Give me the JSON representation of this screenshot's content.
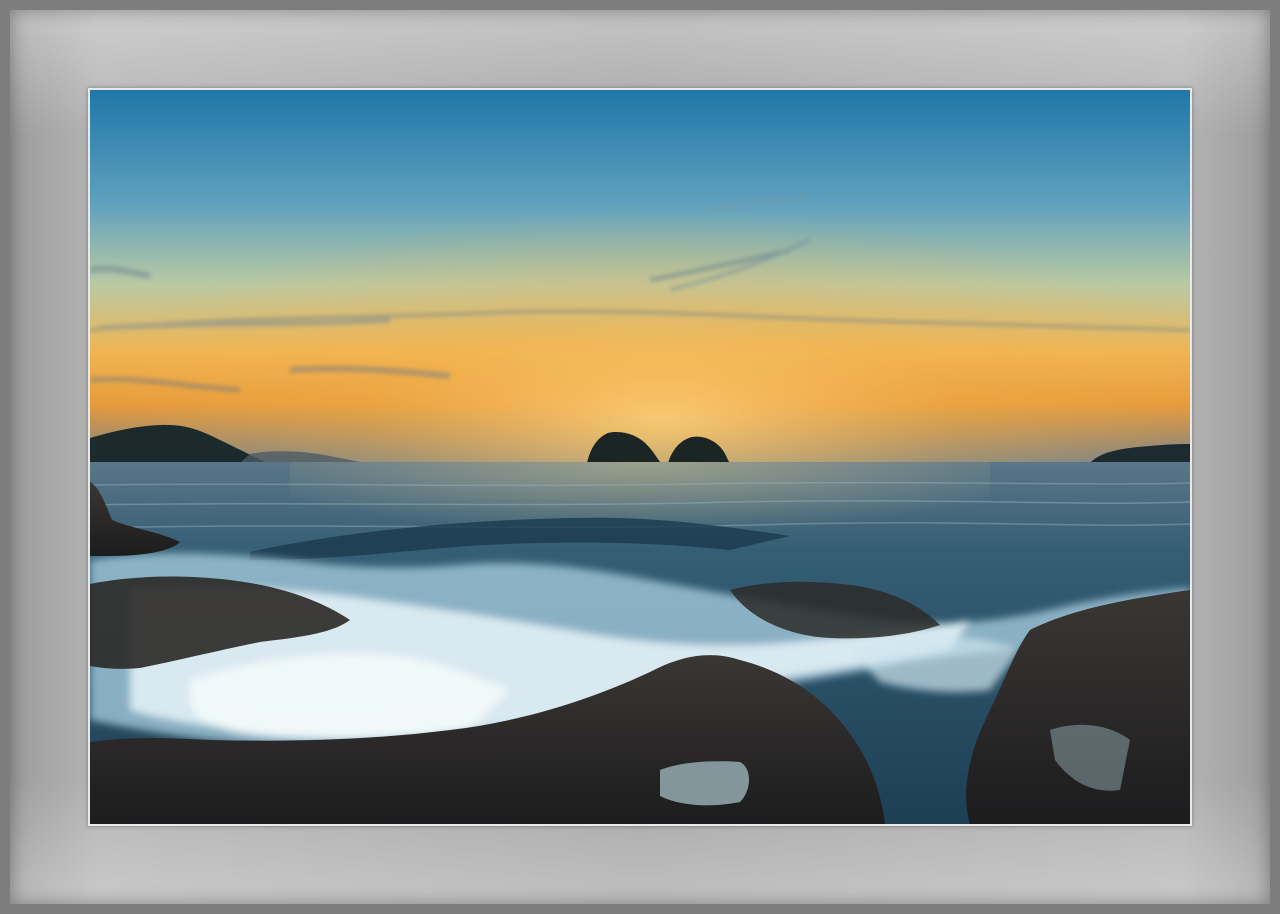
{
  "scene": {
    "subject": "",
    "colors": {
      "sky_top": "#1e78a8",
      "sky_mid": "#8fb9b8",
      "sky_glow": "#f2b14a",
      "horizon": "#6f7e8a",
      "sea": "#2f5d72",
      "foam": "#d8eef6",
      "rock": "#2a2a2c",
      "mat": "#a6a6a6",
      "outer_frame": "#7d7d7d"
    }
  }
}
